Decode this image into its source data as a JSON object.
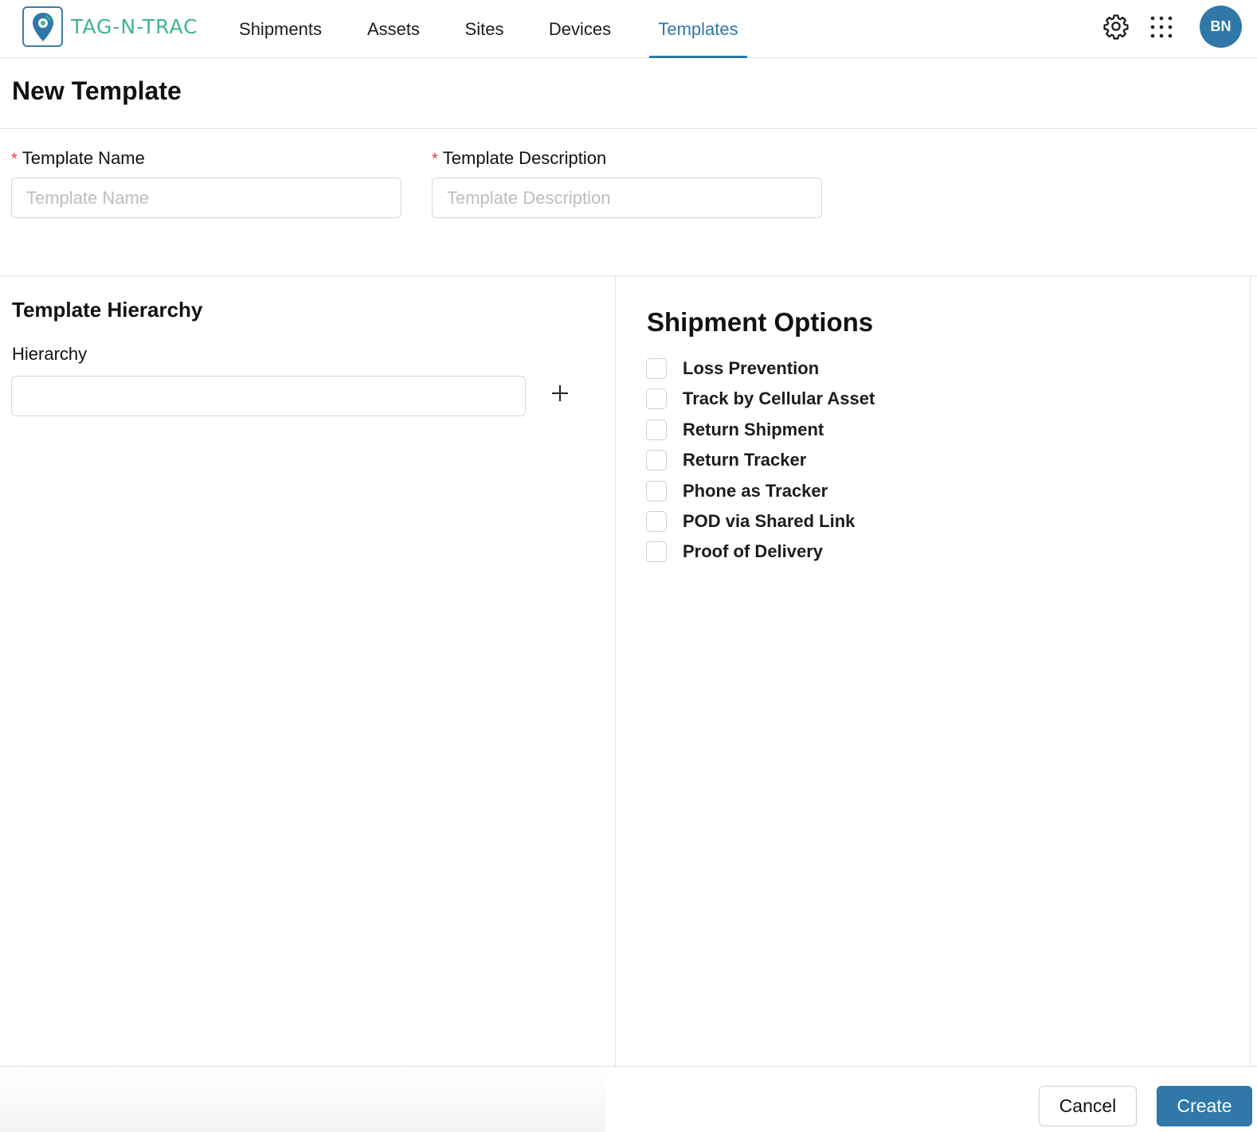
{
  "app": {
    "logo_text": "TAG-N-TRAC",
    "brand_color": "#2f78a8",
    "logo_text_color": "#3fb68b"
  },
  "nav": {
    "tabs": [
      {
        "label": "Shipments",
        "active": false
      },
      {
        "label": "Assets",
        "active": false
      },
      {
        "label": "Sites",
        "active": false
      },
      {
        "label": "Devices",
        "active": false
      },
      {
        "label": "Templates",
        "active": true
      }
    ],
    "icons": [
      "gear-icon",
      "apps-grid-icon"
    ],
    "avatar_initials": "BN"
  },
  "page": {
    "title": "New Template"
  },
  "form": {
    "required_marker": "*",
    "template_name": {
      "label": "Template Name",
      "placeholder": "Template Name",
      "value": ""
    },
    "template_description": {
      "label": "Template Description",
      "placeholder": "Template Description",
      "value": ""
    }
  },
  "hierarchy": {
    "section_title": "Template Hierarchy",
    "label": "Hierarchy",
    "value": "",
    "add_icon": "plus-icon"
  },
  "shipment_options": {
    "title": "Shipment Options",
    "items": [
      {
        "label": "Loss Prevention",
        "checked": false
      },
      {
        "label": "Track by Cellular Asset",
        "checked": false
      },
      {
        "label": "Return Shipment",
        "checked": false
      },
      {
        "label": "Return Tracker",
        "checked": false
      },
      {
        "label": "Phone as Tracker",
        "checked": false
      },
      {
        "label": "POD via Shared Link",
        "checked": false
      },
      {
        "label": "Proof of Delivery",
        "checked": false
      }
    ]
  },
  "footer": {
    "cancel_label": "Cancel",
    "create_label": "Create"
  }
}
